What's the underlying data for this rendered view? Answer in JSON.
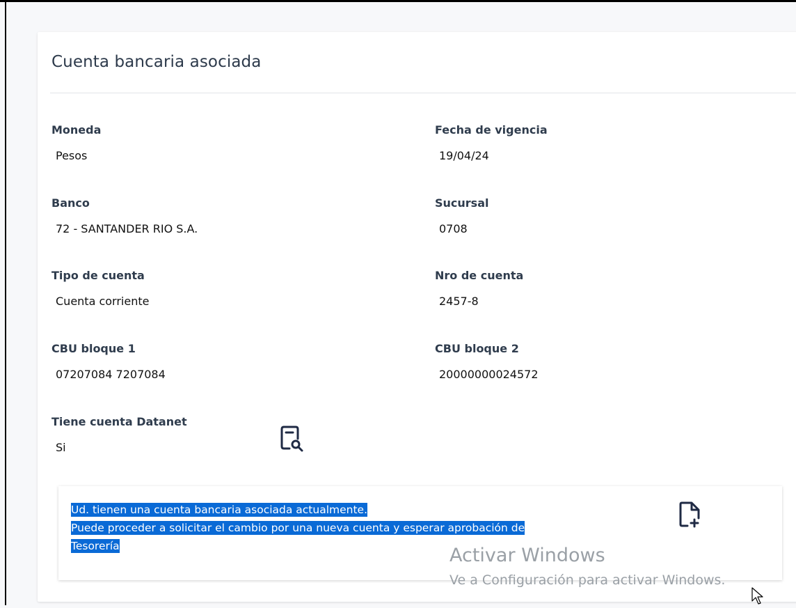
{
  "card": {
    "title": "Cuenta bancaria asociada"
  },
  "fields": {
    "moneda": {
      "label": "Moneda",
      "value": "Pesos"
    },
    "fecha_vigencia": {
      "label": "Fecha de vigencia",
      "value": "19/04/24"
    },
    "banco": {
      "label": "Banco",
      "value": "72 - SANTANDER RIO S.A."
    },
    "sucursal": {
      "label": "Sucursal",
      "value": "0708"
    },
    "tipo_cuenta": {
      "label": "Tipo de cuenta",
      "value": "Cuenta corriente"
    },
    "nro_cuenta": {
      "label": "Nro de cuenta",
      "value": "2457-8"
    },
    "cbu_bloque_1": {
      "label": "CBU bloque 1",
      "value": "07207084 7207084"
    },
    "cbu_bloque_2": {
      "label": "CBU bloque 2",
      "value": "20000000024572"
    },
    "datanet": {
      "label": "Tiene cuenta Datanet",
      "value": "Si"
    }
  },
  "info": {
    "line1": "Ud. tienen una cuenta bancaria asociada actualmente.",
    "line2": "Puede proceder a solicitar el cambio por una nueva cuenta y esperar aprobación de",
    "line3": "Tesorería"
  },
  "icons": {
    "view_document": "document-search-icon",
    "new_document": "document-add-icon"
  },
  "watermark": {
    "title": "Activar Windows",
    "subtitle": "Ve a Configuración para activar Windows."
  },
  "colors": {
    "selection": "#0a6ad6",
    "label": "#2f3c4d",
    "icon": "#1f2a44"
  }
}
